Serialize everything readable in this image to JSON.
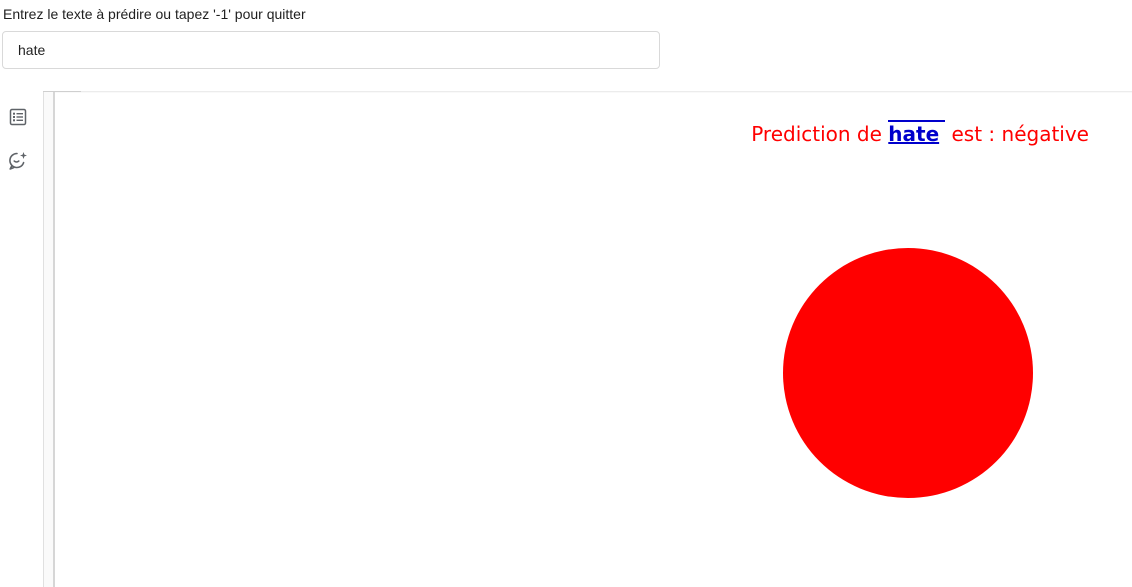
{
  "prompt": {
    "label": "Entrez le texte à prédire ou tapez '-1' pour quitter",
    "input_value": "hate"
  },
  "toolbar": {
    "icons": [
      "list-icon",
      "ai-chat-icon"
    ]
  },
  "output": {
    "prefix": "Prediction de ",
    "word": "hate",
    "suffix": " est : négative",
    "text_color": "#ff0000",
    "word_color": "#0000cc",
    "indicator_color": "#ff0000"
  }
}
